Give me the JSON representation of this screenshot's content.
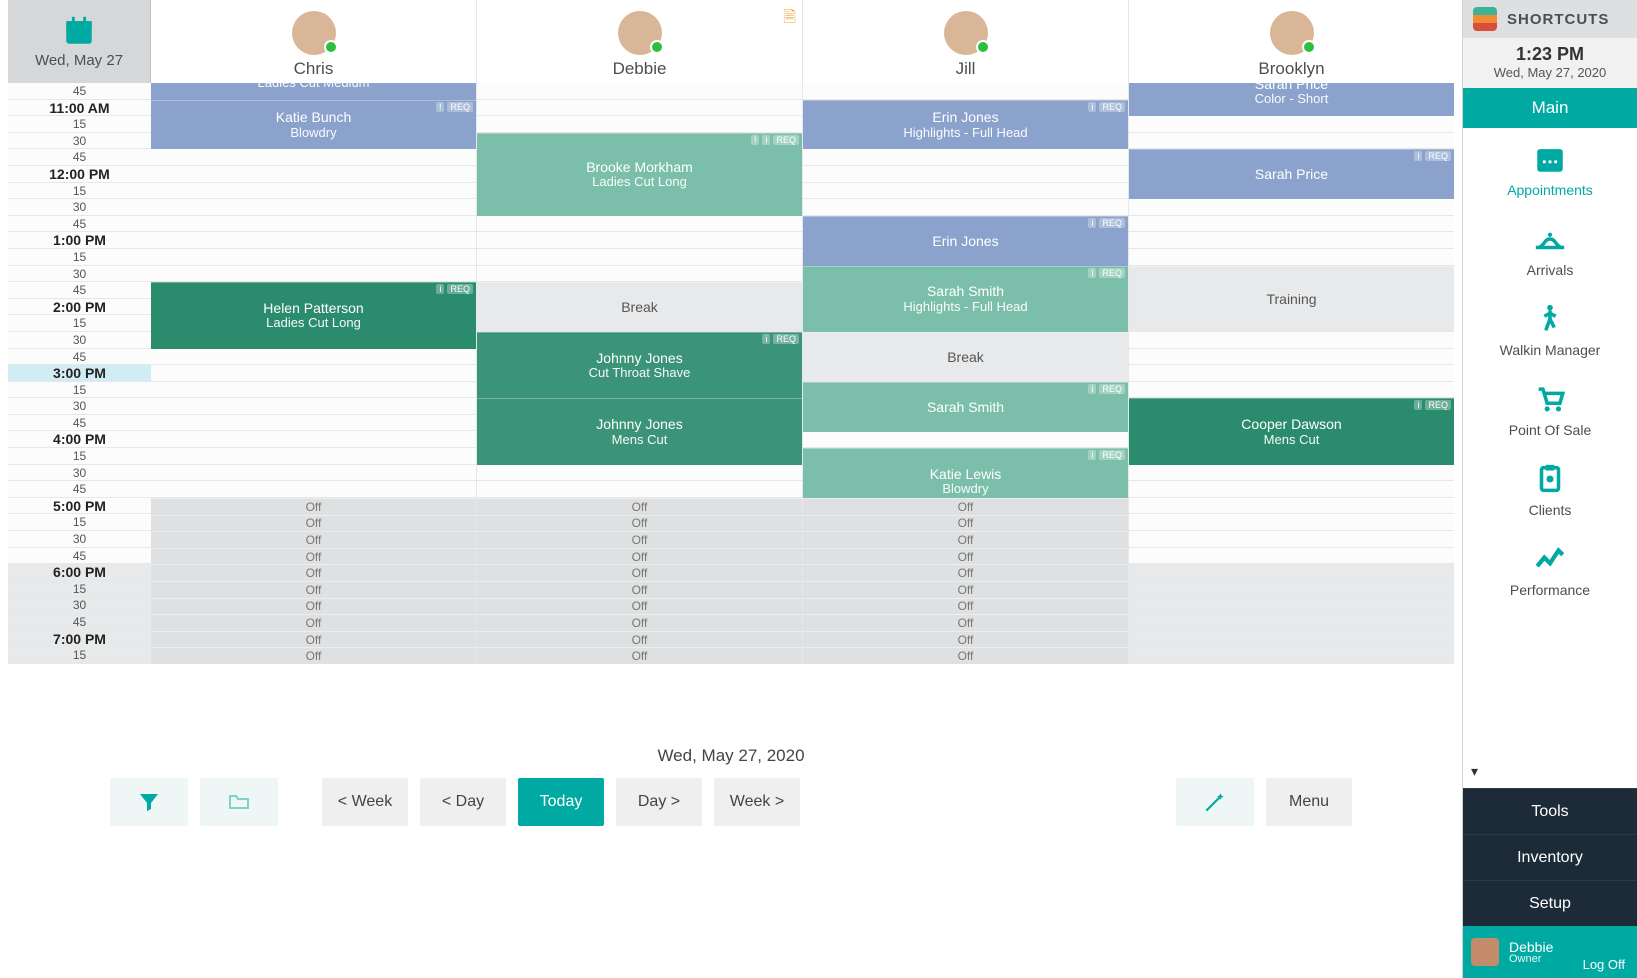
{
  "header": {
    "date_short": "Wed, May 27",
    "staff": [
      {
        "name": "Chris",
        "has_note": false
      },
      {
        "name": "Debbie",
        "has_note": true
      },
      {
        "name": "Jill",
        "has_note": false
      },
      {
        "name": "Brooklyn",
        "has_note": false
      }
    ]
  },
  "time_axis": {
    "start_minute": 645,
    "slot_minutes": 15,
    "slots": [
      {
        "label": "45",
        "hour": false,
        "shade": false
      },
      {
        "label": "11:00 AM",
        "hour": true,
        "shade": false
      },
      {
        "label": "15",
        "hour": false,
        "shade": false
      },
      {
        "label": "30",
        "hour": false,
        "shade": false
      },
      {
        "label": "45",
        "hour": false,
        "shade": false
      },
      {
        "label": "12:00 PM",
        "hour": true,
        "shade": false
      },
      {
        "label": "15",
        "hour": false,
        "shade": false
      },
      {
        "label": "30",
        "hour": false,
        "shade": false
      },
      {
        "label": "45",
        "hour": false,
        "shade": false
      },
      {
        "label": "1:00 PM",
        "hour": true,
        "shade": false
      },
      {
        "label": "15",
        "hour": false,
        "shade": false
      },
      {
        "label": "30",
        "hour": false,
        "shade": false
      },
      {
        "label": "45",
        "hour": false,
        "shade": false
      },
      {
        "label": "2:00 PM",
        "hour": true,
        "shade": false
      },
      {
        "label": "15",
        "hour": false,
        "shade": false
      },
      {
        "label": "30",
        "hour": false,
        "shade": false
      },
      {
        "label": "45",
        "hour": false,
        "shade": false
      },
      {
        "label": "3:00 PM",
        "hour": true,
        "shade": false,
        "highlight": true
      },
      {
        "label": "15",
        "hour": false,
        "shade": false
      },
      {
        "label": "30",
        "hour": false,
        "shade": false
      },
      {
        "label": "45",
        "hour": false,
        "shade": false
      },
      {
        "label": "4:00 PM",
        "hour": true,
        "shade": false
      },
      {
        "label": "15",
        "hour": false,
        "shade": false
      },
      {
        "label": "30",
        "hour": false,
        "shade": false
      },
      {
        "label": "45",
        "hour": false,
        "shade": false
      },
      {
        "label": "5:00 PM",
        "hour": true,
        "shade": false
      },
      {
        "label": "15",
        "hour": false,
        "shade": false
      },
      {
        "label": "30",
        "hour": false,
        "shade": false
      },
      {
        "label": "45",
        "hour": false,
        "shade": false
      },
      {
        "label": "6:00 PM",
        "hour": true,
        "shade": true
      },
      {
        "label": "15",
        "hour": false,
        "shade": true
      },
      {
        "label": "30",
        "hour": false,
        "shade": true
      },
      {
        "label": "45",
        "hour": false,
        "shade": true
      },
      {
        "label": "7:00 PM",
        "hour": true,
        "shade": true
      },
      {
        "label": "15",
        "hour": false,
        "shade": true
      }
    ]
  },
  "appointments": {
    "columns": [
      [
        {
          "start": 630,
          "end": 660,
          "client": "",
          "service": "Ladies Cut Medium",
          "style": "blue"
        },
        {
          "start": 660,
          "end": 705,
          "client": "Katie Bunch",
          "service": "Blowdry",
          "style": "blue",
          "badges": [
            "!",
            "REQ"
          ]
        },
        {
          "start": 825,
          "end": 885,
          "client": "Helen Patterson",
          "service": "Ladies Cut Long",
          "style": "green",
          "badges": [
            "i",
            "REQ"
          ]
        }
      ],
      [
        {
          "start": 690,
          "end": 765,
          "client": "Brooke Morkham",
          "service": "Ladies Cut Long",
          "style": "teal",
          "badges": [
            "!",
            "i",
            "REQ"
          ]
        },
        {
          "start": 825,
          "end": 870,
          "client": "Break",
          "service": "",
          "style": "grey"
        },
        {
          "start": 870,
          "end": 930,
          "client": "Johnny Jones",
          "service": "Cut Throat Shave",
          "style": "greend",
          "badges": [
            "i",
            "REQ"
          ]
        },
        {
          "start": 930,
          "end": 990,
          "client": "Johnny Jones",
          "service": "Mens Cut",
          "style": "greend"
        }
      ],
      [
        {
          "start": 660,
          "end": 705,
          "client": "Erin Jones",
          "service": "Highlights - Full Head",
          "style": "blue",
          "badges": [
            "i",
            "REQ"
          ]
        },
        {
          "start": 765,
          "end": 810,
          "client": "Erin Jones",
          "service": "",
          "style": "blue",
          "badges": [
            "i",
            "REQ"
          ]
        },
        {
          "start": 810,
          "end": 870,
          "client": "Sarah Smith",
          "service": "Highlights - Full Head",
          "style": "teal",
          "badges": [
            "i",
            "REQ"
          ]
        },
        {
          "start": 870,
          "end": 915,
          "client": "Break",
          "service": "",
          "style": "grey"
        },
        {
          "start": 915,
          "end": 960,
          "client": "Sarah Smith",
          "service": "",
          "style": "teal",
          "badges": [
            "i",
            "REQ"
          ]
        },
        {
          "start": 975,
          "end": 1035,
          "client": "Katie Lewis",
          "service": "Blowdry",
          "style": "teal",
          "badges": [
            "i",
            "REQ"
          ]
        }
      ],
      [
        {
          "start": 630,
          "end": 675,
          "client": "Sarah Price",
          "service": "Color - Short",
          "style": "blue"
        },
        {
          "start": 705,
          "end": 750,
          "client": "Sarah Price",
          "service": "",
          "style": "blue",
          "badges": [
            "i",
            "REQ"
          ]
        },
        {
          "start": 810,
          "end": 870,
          "client": "Training",
          "service": "",
          "style": "grey"
        },
        {
          "start": 930,
          "end": 990,
          "client": "Cooper Dawson",
          "service": "Mens Cut",
          "style": "green",
          "badges": [
            "i",
            "REQ"
          ]
        }
      ]
    ],
    "off_label": "Off",
    "off_from_minute": 1020,
    "off_columns": [
      true,
      true,
      true,
      false
    ]
  },
  "footer": {
    "date_long": "Wed, May 27, 2020",
    "buttons": {
      "prev_week": "< Week",
      "prev_day": "< Day",
      "today": "Today",
      "next_day": "Day >",
      "next_week": "Week >",
      "menu": "Menu"
    }
  },
  "sidebar": {
    "brand": "SHORTCUTS",
    "clock": {
      "time": "1:23 PM",
      "date": "Wed, May 27, 2020"
    },
    "main_label": "Main",
    "nav": [
      {
        "label": "Appointments",
        "icon": "calendar-icon",
        "active": true
      },
      {
        "label": "Arrivals",
        "icon": "bell-icon",
        "active": false
      },
      {
        "label": "Walkin Manager",
        "icon": "walk-icon",
        "active": false
      },
      {
        "label": "Point Of Sale",
        "icon": "cart-icon",
        "active": false
      },
      {
        "label": "Clients",
        "icon": "clipboard-icon",
        "active": false
      },
      {
        "label": "Performance",
        "icon": "chart-icon",
        "active": false
      }
    ],
    "dark_items": [
      "Tools",
      "Inventory",
      "Setup"
    ],
    "user": {
      "name": "Debbie",
      "role": "Owner",
      "logoff": "Log Off"
    }
  }
}
